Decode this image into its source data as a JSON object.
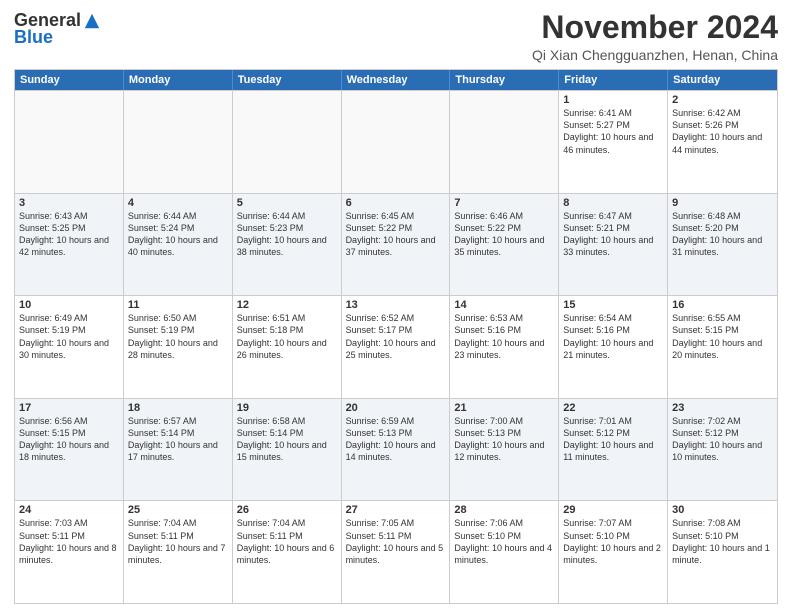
{
  "logo": {
    "general": "General",
    "blue": "Blue"
  },
  "title": "November 2024",
  "location": "Qi Xian Chengguanzhen, Henan, China",
  "days_of_week": [
    "Sunday",
    "Monday",
    "Tuesday",
    "Wednesday",
    "Thursday",
    "Friday",
    "Saturday"
  ],
  "rows": [
    [
      {
        "day": "",
        "info": ""
      },
      {
        "day": "",
        "info": ""
      },
      {
        "day": "",
        "info": ""
      },
      {
        "day": "",
        "info": ""
      },
      {
        "day": "",
        "info": ""
      },
      {
        "day": "1",
        "info": "Sunrise: 6:41 AM\nSunset: 5:27 PM\nDaylight: 10 hours and 46 minutes."
      },
      {
        "day": "2",
        "info": "Sunrise: 6:42 AM\nSunset: 5:26 PM\nDaylight: 10 hours and 44 minutes."
      }
    ],
    [
      {
        "day": "3",
        "info": "Sunrise: 6:43 AM\nSunset: 5:25 PM\nDaylight: 10 hours and 42 minutes."
      },
      {
        "day": "4",
        "info": "Sunrise: 6:44 AM\nSunset: 5:24 PM\nDaylight: 10 hours and 40 minutes."
      },
      {
        "day": "5",
        "info": "Sunrise: 6:44 AM\nSunset: 5:23 PM\nDaylight: 10 hours and 38 minutes."
      },
      {
        "day": "6",
        "info": "Sunrise: 6:45 AM\nSunset: 5:22 PM\nDaylight: 10 hours and 37 minutes."
      },
      {
        "day": "7",
        "info": "Sunrise: 6:46 AM\nSunset: 5:22 PM\nDaylight: 10 hours and 35 minutes."
      },
      {
        "day": "8",
        "info": "Sunrise: 6:47 AM\nSunset: 5:21 PM\nDaylight: 10 hours and 33 minutes."
      },
      {
        "day": "9",
        "info": "Sunrise: 6:48 AM\nSunset: 5:20 PM\nDaylight: 10 hours and 31 minutes."
      }
    ],
    [
      {
        "day": "10",
        "info": "Sunrise: 6:49 AM\nSunset: 5:19 PM\nDaylight: 10 hours and 30 minutes."
      },
      {
        "day": "11",
        "info": "Sunrise: 6:50 AM\nSunset: 5:19 PM\nDaylight: 10 hours and 28 minutes."
      },
      {
        "day": "12",
        "info": "Sunrise: 6:51 AM\nSunset: 5:18 PM\nDaylight: 10 hours and 26 minutes."
      },
      {
        "day": "13",
        "info": "Sunrise: 6:52 AM\nSunset: 5:17 PM\nDaylight: 10 hours and 25 minutes."
      },
      {
        "day": "14",
        "info": "Sunrise: 6:53 AM\nSunset: 5:16 PM\nDaylight: 10 hours and 23 minutes."
      },
      {
        "day": "15",
        "info": "Sunrise: 6:54 AM\nSunset: 5:16 PM\nDaylight: 10 hours and 21 minutes."
      },
      {
        "day": "16",
        "info": "Sunrise: 6:55 AM\nSunset: 5:15 PM\nDaylight: 10 hours and 20 minutes."
      }
    ],
    [
      {
        "day": "17",
        "info": "Sunrise: 6:56 AM\nSunset: 5:15 PM\nDaylight: 10 hours and 18 minutes."
      },
      {
        "day": "18",
        "info": "Sunrise: 6:57 AM\nSunset: 5:14 PM\nDaylight: 10 hours and 17 minutes."
      },
      {
        "day": "19",
        "info": "Sunrise: 6:58 AM\nSunset: 5:14 PM\nDaylight: 10 hours and 15 minutes."
      },
      {
        "day": "20",
        "info": "Sunrise: 6:59 AM\nSunset: 5:13 PM\nDaylight: 10 hours and 14 minutes."
      },
      {
        "day": "21",
        "info": "Sunrise: 7:00 AM\nSunset: 5:13 PM\nDaylight: 10 hours and 12 minutes."
      },
      {
        "day": "22",
        "info": "Sunrise: 7:01 AM\nSunset: 5:12 PM\nDaylight: 10 hours and 11 minutes."
      },
      {
        "day": "23",
        "info": "Sunrise: 7:02 AM\nSunset: 5:12 PM\nDaylight: 10 hours and 10 minutes."
      }
    ],
    [
      {
        "day": "24",
        "info": "Sunrise: 7:03 AM\nSunset: 5:11 PM\nDaylight: 10 hours and 8 minutes."
      },
      {
        "day": "25",
        "info": "Sunrise: 7:04 AM\nSunset: 5:11 PM\nDaylight: 10 hours and 7 minutes."
      },
      {
        "day": "26",
        "info": "Sunrise: 7:04 AM\nSunset: 5:11 PM\nDaylight: 10 hours and 6 minutes."
      },
      {
        "day": "27",
        "info": "Sunrise: 7:05 AM\nSunset: 5:11 PM\nDaylight: 10 hours and 5 minutes."
      },
      {
        "day": "28",
        "info": "Sunrise: 7:06 AM\nSunset: 5:10 PM\nDaylight: 10 hours and 4 minutes."
      },
      {
        "day": "29",
        "info": "Sunrise: 7:07 AM\nSunset: 5:10 PM\nDaylight: 10 hours and 2 minutes."
      },
      {
        "day": "30",
        "info": "Sunrise: 7:08 AM\nSunset: 5:10 PM\nDaylight: 10 hours and 1 minute."
      }
    ]
  ]
}
